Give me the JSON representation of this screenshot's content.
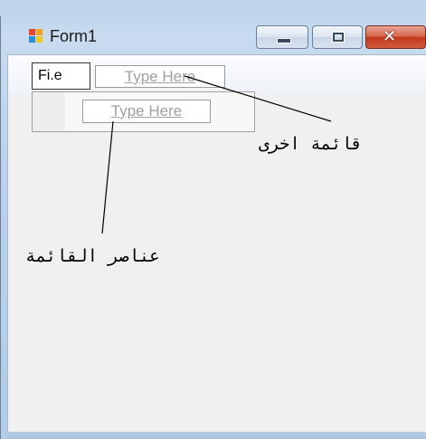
{
  "window": {
    "title": "Form1",
    "controls": {
      "minimize": "minimize",
      "maximize": "maximize",
      "close": "✕"
    }
  },
  "menu_strip": {
    "top_item": "Fi.e",
    "top_placeholder": "Type Here",
    "dropdown_placeholder": "Type Here"
  },
  "annotations": {
    "other_menu": "قائمة اخرى",
    "menu_items": "عناصر القائمة"
  },
  "colors": {
    "frame": "#bcd3ea",
    "client": "#f0f0f0",
    "close_button": "#c2381c"
  },
  "icons": [
    "app-icon",
    "minimize-icon",
    "maximize-icon",
    "close-icon"
  ]
}
